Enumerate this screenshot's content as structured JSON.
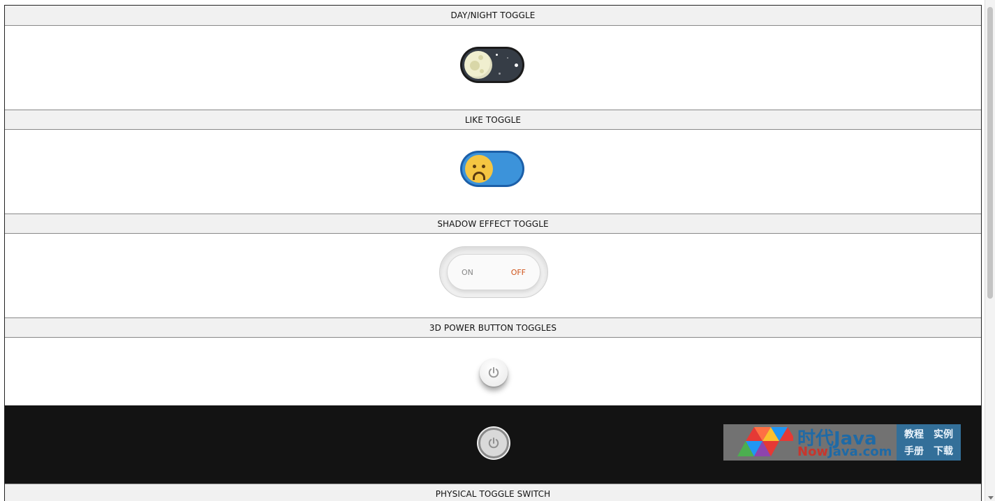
{
  "sections": [
    {
      "title": "DAY/NIGHT TOGGLE"
    },
    {
      "title": "LIKE TOGGLE"
    },
    {
      "title": "SHADOW EFFECT TOGGLE"
    },
    {
      "title": "3D POWER BUTTON TOGGLES"
    },
    {
      "title": "PHYSICAL TOGGLE SWITCH"
    }
  ],
  "shadow_toggle": {
    "on_label": "ON",
    "off_label": "OFF",
    "active": "OFF"
  },
  "watermark": {
    "brand_cn": "时代Java",
    "url_red": "Now",
    "url_blue": "Java.com",
    "links": [
      "教程",
      "实例",
      "手册",
      "下载"
    ]
  },
  "colors": {
    "section_bar": "#f1f1f1",
    "dark_band": "#131313",
    "like_blue": "#3c93da",
    "off_accent": "#d0541b"
  }
}
